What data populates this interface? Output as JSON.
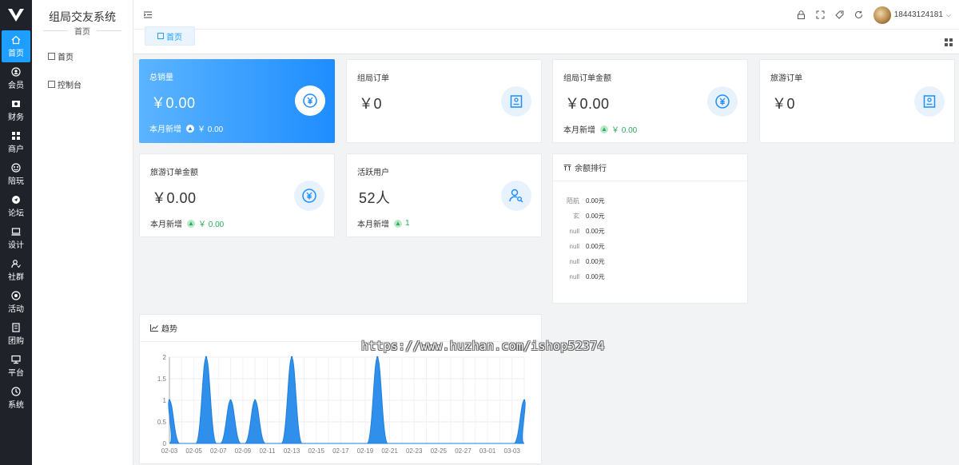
{
  "app": {
    "title": "组局交友系统",
    "section": "首页"
  },
  "rail": [
    {
      "label": "首页",
      "icon": "home-icon",
      "active": true
    },
    {
      "label": "会员",
      "icon": "member-icon"
    },
    {
      "label": "财务",
      "icon": "finance-icon"
    },
    {
      "label": "商户",
      "icon": "merchant-icon"
    },
    {
      "label": "陪玩",
      "icon": "companion-icon"
    },
    {
      "label": "论坛",
      "icon": "forum-icon"
    },
    {
      "label": "设计",
      "icon": "design-icon"
    },
    {
      "label": "社群",
      "icon": "community-icon"
    },
    {
      "label": "活动",
      "icon": "activity-icon"
    },
    {
      "label": "团购",
      "icon": "groupbuy-icon"
    },
    {
      "label": "平台",
      "icon": "platform-icon"
    },
    {
      "label": "系统",
      "icon": "system-icon"
    }
  ],
  "submenu": [
    {
      "label": "首页"
    },
    {
      "label": "控制台"
    }
  ],
  "header": {
    "username": "18443124181"
  },
  "tabs": [
    {
      "label": "首页"
    }
  ],
  "cards": {
    "total_sales": {
      "title": "总销量",
      "value": "￥0.00",
      "foot_label": "本月新增",
      "foot_value": "￥ 0.00"
    },
    "group_orders": {
      "title": "组局订单",
      "value": "￥0"
    },
    "group_order_amount": {
      "title": "组局订单金额",
      "value": "￥0.00",
      "foot_label": "本月新增",
      "foot_value": "￥ 0.00"
    },
    "travel_orders": {
      "title": "旅游订单",
      "value": "￥0"
    },
    "travel_order_amount": {
      "title": "旅游订单金额",
      "value": "￥0.00",
      "foot_label": "本月新增",
      "foot_value": "￥ 0.00"
    },
    "active_users": {
      "title": "活跃用户",
      "value": "52人",
      "foot_label": "本月新增",
      "foot_value": "1"
    }
  },
  "ranking": {
    "title": "余额排行",
    "rows": [
      {
        "name": "陌航",
        "value": "0.00元"
      },
      {
        "name": "玄",
        "value": "0.00元"
      },
      {
        "name": "null",
        "value": "0.00元"
      },
      {
        "name": "null",
        "value": "0.00元"
      },
      {
        "name": "null",
        "value": "0.00元"
      },
      {
        "name": "null",
        "value": "0.00元"
      }
    ]
  },
  "trend": {
    "title": "趋势"
  },
  "chart_data": {
    "type": "area",
    "title": "趋势",
    "x": [
      "02-03",
      "02-04",
      "02-05",
      "02-06",
      "02-07",
      "02-08",
      "02-09",
      "02-10",
      "02-11",
      "02-12",
      "02-13",
      "02-14",
      "02-15",
      "02-16",
      "02-17",
      "02-18",
      "02-19",
      "02-20",
      "02-21",
      "02-22",
      "02-23",
      "02-24",
      "02-25",
      "02-26",
      "02-27",
      "02-28",
      "03-01",
      "03-02",
      "03-03",
      "03-04"
    ],
    "x_tick_labels": [
      "02-03",
      "02-05",
      "02-07",
      "02-09",
      "02-11",
      "02-13",
      "02-15",
      "02-17",
      "02-19",
      "02-21",
      "02-23",
      "02-25",
      "02-27",
      "03-01",
      "03-03"
    ],
    "y_tick_labels": [
      "0",
      "0.5",
      "1",
      "1.5",
      "2"
    ],
    "series": [
      {
        "values": [
          1,
          0,
          0,
          2,
          0,
          1,
          0,
          1,
          0,
          0,
          2,
          0,
          0,
          0,
          0,
          0,
          0,
          2,
          0,
          0,
          0,
          0,
          0,
          0,
          0,
          0,
          0,
          0,
          0,
          1
        ]
      }
    ],
    "ylim": [
      0,
      2
    ],
    "grid": true,
    "colors": {
      "fill": "#2f8fea",
      "stroke": "#1f7fde"
    }
  },
  "watermark": "https://www.huzhan.com/ishop52374"
}
